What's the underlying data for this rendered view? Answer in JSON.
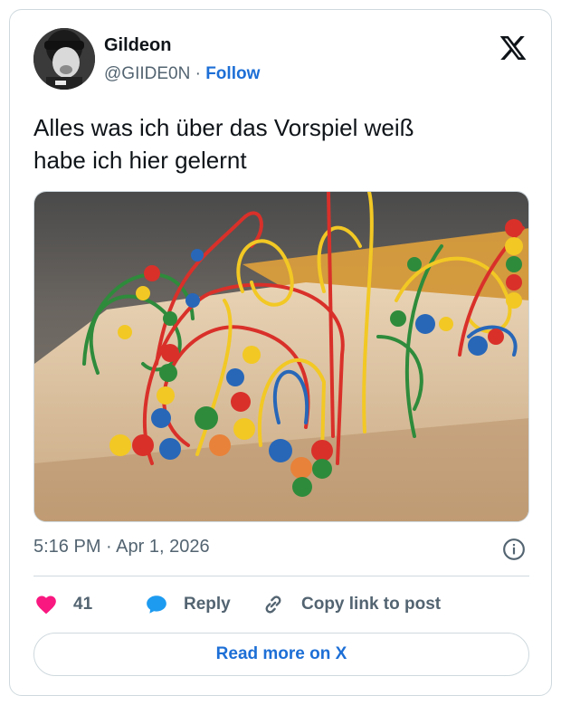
{
  "author": {
    "display_name": "Gildeon",
    "handle": "@GIIDE0N",
    "separator": "·",
    "follow_label": "Follow"
  },
  "tweet": {
    "text_lines": [
      "Alles was ich über das Vorspiel weiß",
      "habe ich hier gelernt"
    ],
    "timestamp": "5:16 PM · Apr 1, 2026"
  },
  "actions": {
    "like_count": "41",
    "reply_label": "Reply",
    "copy_label": "Copy link to post"
  },
  "footer": {
    "read_more_label": "Read more on X"
  },
  "icons": {
    "platform": "x-logo-icon",
    "info": "info-icon",
    "like": "heart-icon",
    "reply": "speech-bubble-icon",
    "copy": "link-icon"
  },
  "colors": {
    "accent": "#1d6fd6",
    "heart": "#f91880",
    "reply": "#1d9bf0",
    "muted_text": "#536471",
    "border": "#cfd9de"
  }
}
